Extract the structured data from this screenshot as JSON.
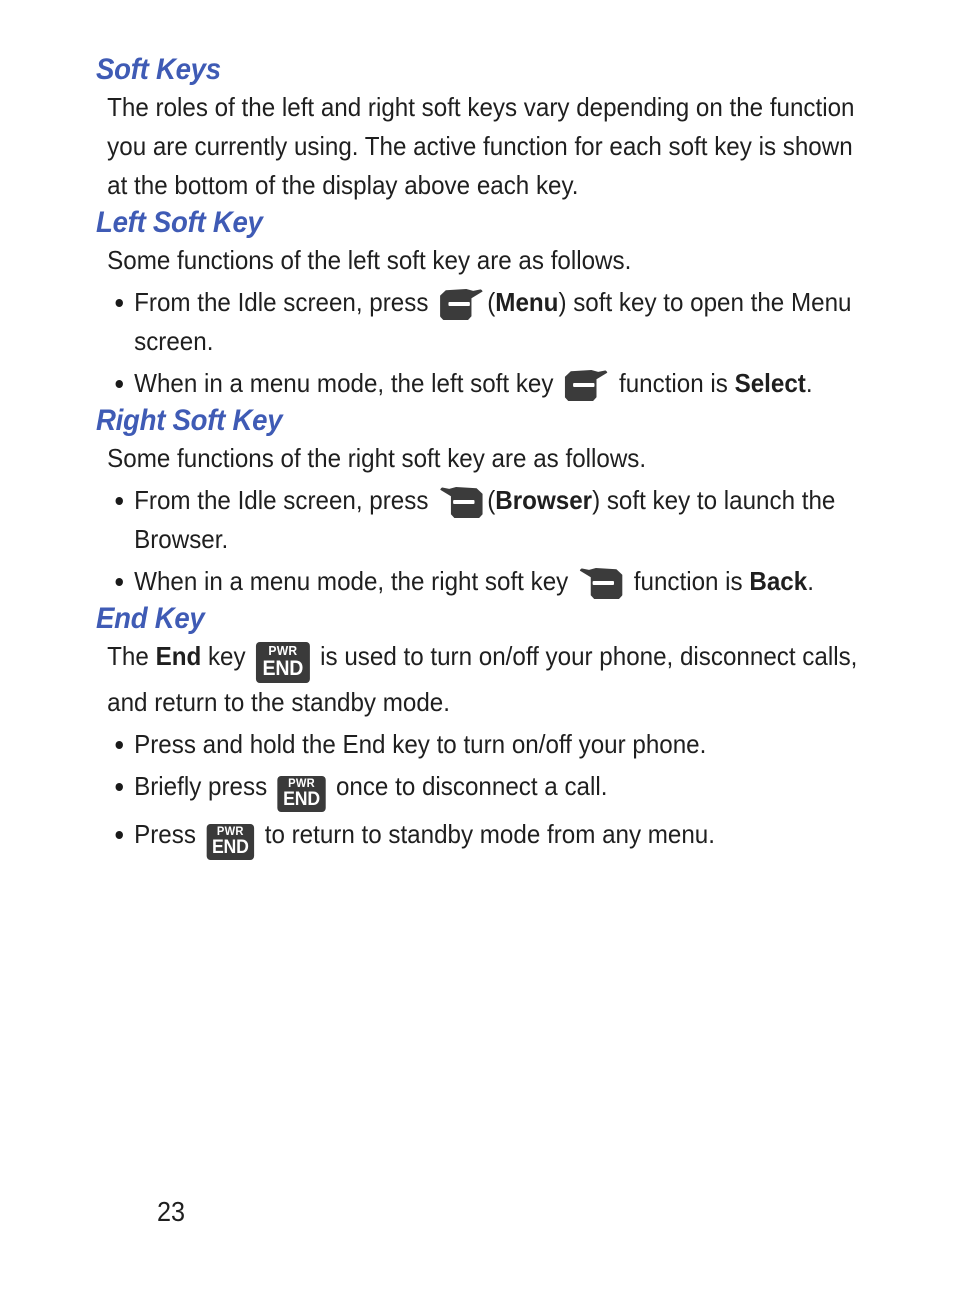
{
  "document": {
    "page_number": "23",
    "accent_color": "#3f5bb5",
    "text_color": "#1f1f1f",
    "key_icon_color": "#3b3b3b"
  },
  "sections": [
    {
      "id": "soft-keys",
      "heading": "Soft Keys",
      "paragraph": "The roles of the left and right soft keys vary depending on the function you are currently using. The active function for each soft key is shown at the bottom of the display above each key."
    },
    {
      "id": "left-soft-key",
      "heading": "Left Soft Key",
      "paragraph": "Some functions of the left soft key are as follows.",
      "bullets": [
        {
          "before": "From the Idle screen, press",
          "icon": "left-soft-key-icon",
          "after_open": "(",
          "bold": "Menu",
          "after": ") soft key to open the Menu screen."
        },
        {
          "before": "When in a menu mode, the left soft key",
          "icon": "left-soft-key-icon",
          "mid": "function is",
          "bold": "Select",
          "after": "."
        }
      ]
    },
    {
      "id": "right-soft-key",
      "heading": "Right Soft Key",
      "paragraph": "Some functions of the right soft key are as follows.",
      "bullets": [
        {
          "before": "From the Idle screen, press",
          "icon": "right-soft-key-icon",
          "after_open": "(",
          "bold": "Browser",
          "after": ") soft key to launch the Browser."
        },
        {
          "before": "When in a menu mode, the right soft key",
          "icon": "right-soft-key-icon",
          "mid": "function is",
          "bold": "Back",
          "after": "."
        }
      ]
    },
    {
      "id": "end-key",
      "heading": "End Key",
      "paragraph_before": "The",
      "paragraph_bold": "End",
      "paragraph_mid": "key",
      "paragraph_after": "is used to turn on/off your phone, disconnect calls, and return to the standby mode.",
      "bullets": [
        {
          "text": "Press and hold the End key to turn on/off your phone."
        },
        {
          "before": "Briefly press",
          "icon": "pwr-end-key-icon",
          "after": "once to disconnect a call."
        },
        {
          "before": "Press",
          "icon": "pwr-end-key-icon",
          "after": "to return to standby mode from any menu."
        }
      ]
    }
  ],
  "key_icons": {
    "pwr_end": {
      "top_label": "PWR",
      "bottom_label": "END"
    }
  }
}
